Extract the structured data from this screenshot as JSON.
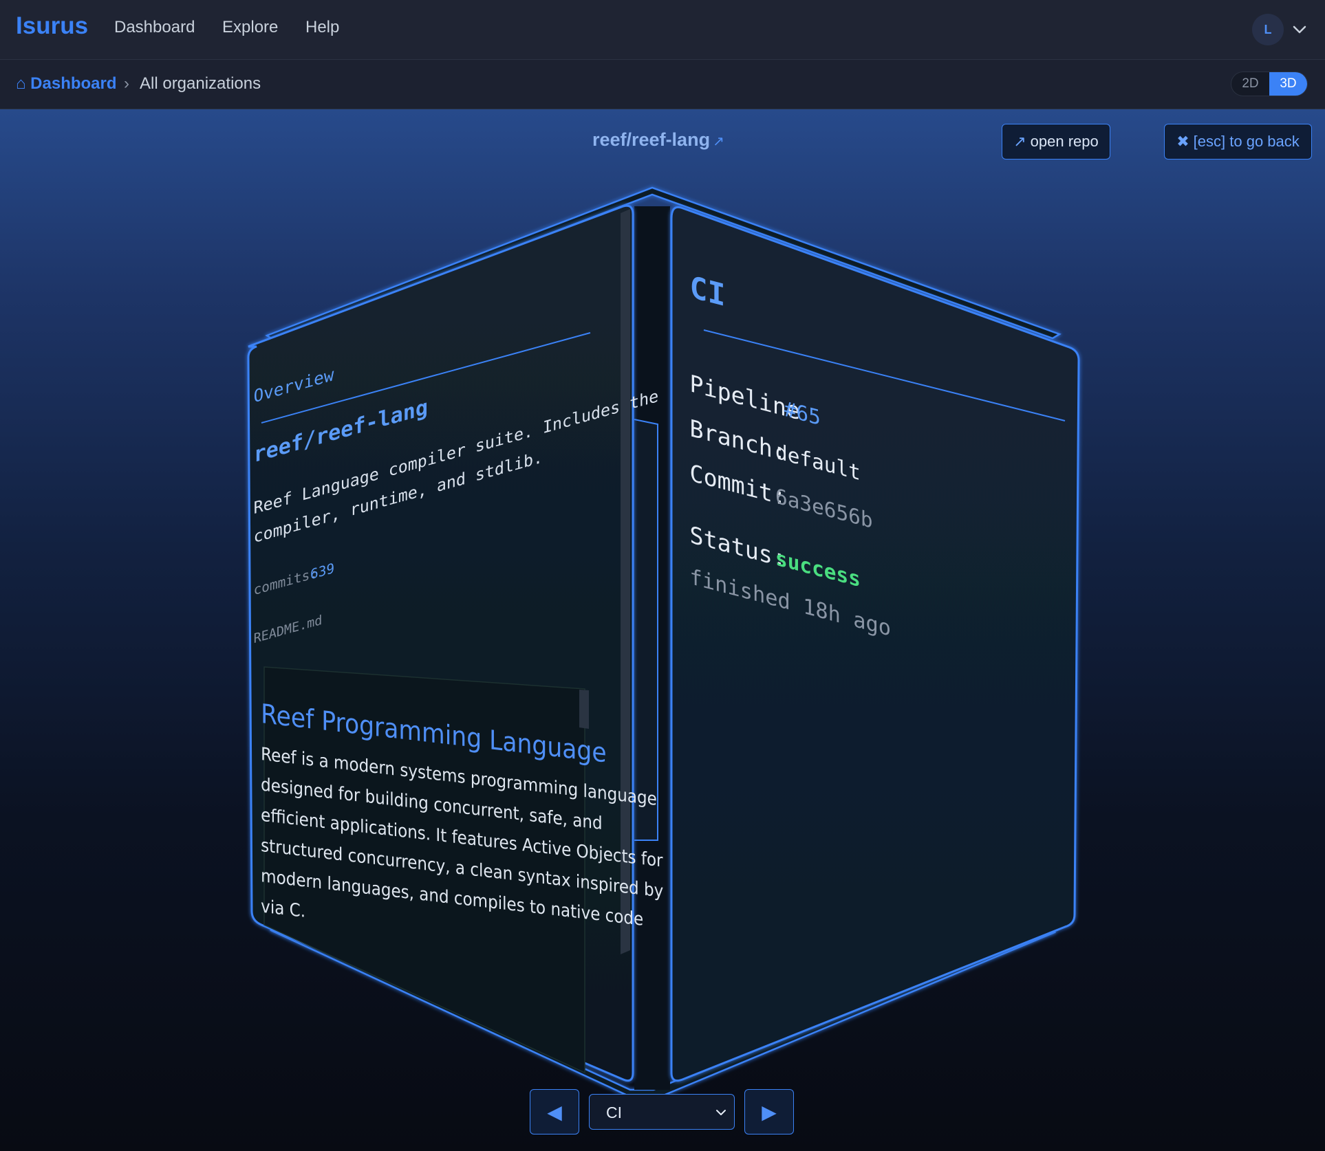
{
  "app": {
    "brand": "Isurus"
  },
  "nav": {
    "items": [
      "Dashboard",
      "Explore",
      "Help"
    ]
  },
  "user": {
    "avatar_initial": "L"
  },
  "breadcrumb": {
    "home_glyph": "⌂",
    "home": "Dashboard",
    "separator": "›",
    "current": "All organizations"
  },
  "view_toggle": {
    "option_2d": "2D",
    "option_3d": "3D",
    "selected": "3D"
  },
  "header": {
    "repo": "reef/reef-lang",
    "ext_glyph": "↗",
    "open_repo_glyph": "↗",
    "open_repo": "open repo",
    "back_glyph": "✖",
    "back": "[esc] to go back"
  },
  "overview": {
    "title": "Overview",
    "repo_name": "reef/reef-lang",
    "description_lines": [
      "Reef Language compiler suite. Includes the",
      "compiler, runtime, and stdlib."
    ],
    "commits_label": "commits:",
    "commits_value": "639",
    "readme_label": "README.md",
    "readme_heading": "Reef Programming Language",
    "readme_lines": [
      "Reef is a modern systems programming language",
      "designed for building concurrent, safe, and",
      "efficient applications. It features Active Objects for",
      "structured concurrency, a clean syntax inspired by",
      "modern languages, and compiles to native code",
      "via C."
    ]
  },
  "ci": {
    "title": "CI",
    "pipeline_label": "Pipeline",
    "pipeline_value": "#65",
    "branch_label": "Branch:",
    "branch_value": "default",
    "commit_label": "Commit:",
    "commit_value": "6a3e656b",
    "status_label": "Status:",
    "status_value": "success",
    "finished": "finished 18h ago"
  },
  "face_selector": {
    "selected": "CI",
    "prev_glyph": "◀",
    "next_glyph": "▶"
  },
  "colors": {
    "accent": "#3b82f6",
    "success": "#4ade80",
    "face_bg": "#112030"
  }
}
